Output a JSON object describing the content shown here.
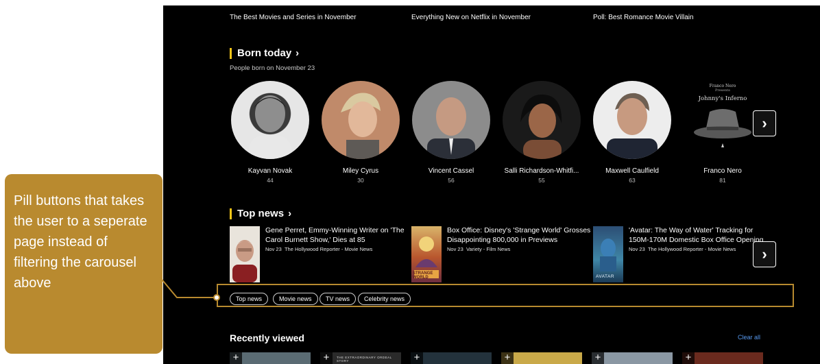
{
  "top_links": [
    "The Best Movies and Series in November",
    "Everything New on Netflix in November",
    "Poll: Best Romance Movie Villain"
  ],
  "born_today": {
    "title": "Born today",
    "subtitle": "People born on November 23",
    "people": [
      {
        "name": "Kayvan Novak",
        "age": "44"
      },
      {
        "name": "Miley Cyrus",
        "age": "30"
      },
      {
        "name": "Vincent Cassel",
        "age": "56"
      },
      {
        "name": "Salli Richardson-Whitfi...",
        "age": "55"
      },
      {
        "name": "Maxwell Caulfield",
        "age": "63"
      },
      {
        "name": "Franco Nero",
        "age": "81"
      }
    ],
    "poster_text": {
      "top": "Franco Nero",
      "presents": "Presents",
      "title": "Johnny's Inferno"
    }
  },
  "top_news": {
    "title": "Top news",
    "items": [
      {
        "title": "Gene Perret, Emmy-Winning Writer on 'The Carol Burnett Show,' Dies at 85",
        "date": "Nov 23",
        "source": "The Hollywood Reporter - Movie News"
      },
      {
        "title": "Box Office: Disney's 'Strange World' Grosses Disappointing 800,000 in Previews",
        "date": "Nov 23",
        "source": "Variety - Film News",
        "thumb_text": "STRANGE WORLD"
      },
      {
        "title": "'Avatar: The Way of Water' Tracking for 150M-170M Domestic Box Office Opening",
        "date": "Nov 23",
        "source": "The Hollywood Reporter - Movie News",
        "thumb_text": "AVATAR"
      }
    ]
  },
  "pills": [
    "Top news",
    "Movie news",
    "TV news",
    "Celebrity news"
  ],
  "recently_viewed": {
    "title": "Recently viewed",
    "clear_label": "Clear all",
    "tile_texts": [
      "",
      "THE EXTRAORDINARY ORDEAL STORY",
      "",
      "",
      "",
      ""
    ]
  },
  "callout": {
    "text": "Pill buttons that takes the user to a seperate page instead of filtering the carousel above"
  },
  "colors": {
    "accent_yellow": "#f5c518",
    "annotation_gold": "#b98a2f",
    "link_blue": "#5799ef",
    "background": "#000000"
  }
}
